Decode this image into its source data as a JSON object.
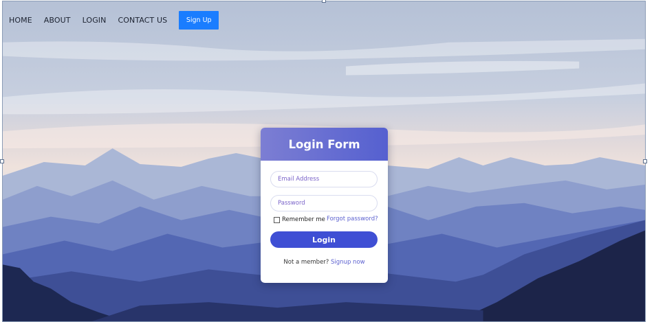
{
  "nav": {
    "home": "HOME",
    "about": "ABOUT",
    "login": "LOGIN",
    "contact": "CONTACT US",
    "signup": "Sign Up"
  },
  "form": {
    "title": "Login Form",
    "email_placeholder": "Email Address",
    "password_placeholder": "Password",
    "remember_label": "Remember me",
    "forgot_label": "Forgot password?",
    "login_label": "Login",
    "member_text": "Not a member?",
    "signup_link": "Signup now"
  },
  "colors": {
    "signup_button": "#1a7dff",
    "header_gradient_start": "#7c7ed3",
    "header_gradient_end": "#5560d0",
    "login_button": "#3f4fd4",
    "link": "#5a5fcf"
  },
  "background": "mountain-landscape-image"
}
